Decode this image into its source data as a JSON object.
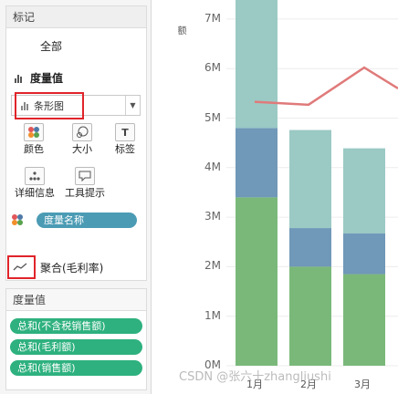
{
  "marks": {
    "title": "标记",
    "all_label": "全部",
    "measure_label": "度量值",
    "mark_type": "条形图",
    "buttons": [
      {
        "label": "颜色",
        "icon": "color-dots-icon"
      },
      {
        "label": "大小",
        "icon": "size-icon"
      },
      {
        "label": "标签",
        "icon": "label-icon"
      },
      {
        "label": "详细信息",
        "icon": "detail-icon"
      },
      {
        "label": "工具提示",
        "icon": "tooltip-icon"
      }
    ],
    "color_pill": "度量名称",
    "aggregate_label": "聚合(毛利率)"
  },
  "measures": {
    "title": "度量值",
    "pills": [
      "总和(不含税销售额)",
      "总和(毛利额)",
      "总和(销售额)"
    ]
  },
  "colors": {
    "green": "#7ab87a",
    "blue": "#7098b8",
    "teal": "#9bc9c4",
    "line": "#e07a7a",
    "highlight": "#e0242a"
  },
  "chart_data": {
    "type": "bar",
    "ylabel": "额",
    "y_ticks": [
      "7M",
      "6M",
      "5M",
      "4M",
      "3M",
      "2M",
      "1M",
      "0M"
    ],
    "ylim": [
      0,
      7600000
    ],
    "categories": [
      "1月",
      "2月",
      "3月"
    ],
    "series": [
      {
        "values": [
          3400000,
          2000000,
          1850000
        ]
      },
      {
        "values": [
          1400000,
          780000,
          820000
        ]
      },
      {
        "values": [
          2800000,
          1980000,
          1720000
        ]
      }
    ],
    "line": {
      "values": [
        5330000,
        5270000,
        6020000,
        5600000
      ]
    }
  },
  "watermark": "CSDN @张六十zhangliushi"
}
